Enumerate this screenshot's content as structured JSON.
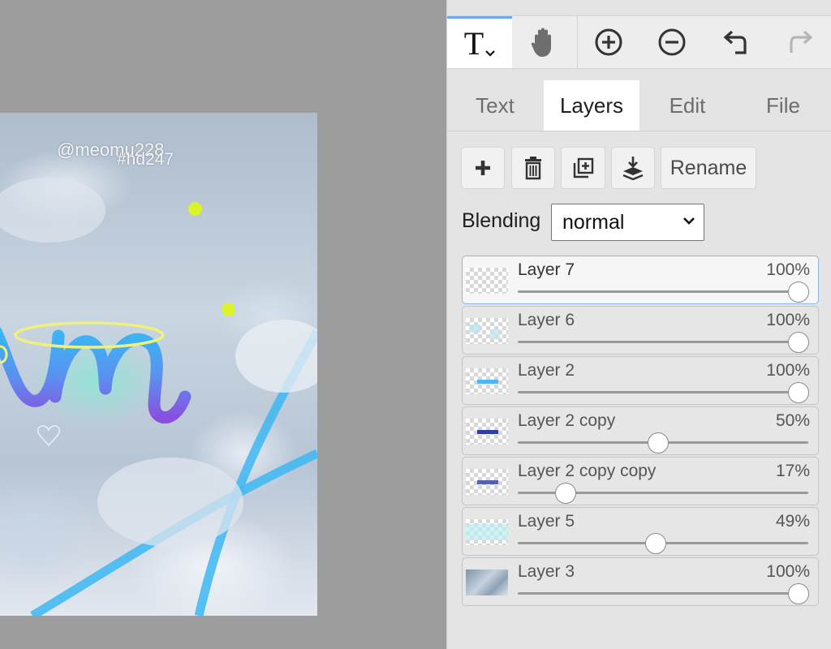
{
  "canvas": {
    "watermark_1": "@meomu228",
    "watermark_2": "#hd247"
  },
  "toolbar": {
    "tools": [
      {
        "name": "text-tool",
        "icon": "text-T-icon",
        "label": "T",
        "active": true
      },
      {
        "name": "hand-tool",
        "icon": "hand-icon"
      },
      {
        "name": "zoom-in",
        "icon": "plus-circle-icon"
      },
      {
        "name": "zoom-out",
        "icon": "minus-circle-icon"
      },
      {
        "name": "undo",
        "icon": "undo-icon"
      },
      {
        "name": "redo",
        "icon": "redo-icon",
        "disabled": true
      }
    ]
  },
  "tabs": [
    {
      "label": "Text",
      "active": false
    },
    {
      "label": "Layers",
      "active": true
    },
    {
      "label": "Edit",
      "active": false
    },
    {
      "label": "File",
      "active": false
    }
  ],
  "layer_actions": {
    "add_icon": "plus-icon",
    "delete_icon": "trash-icon",
    "duplicate_icon": "duplicate-icon",
    "merge_down_icon": "merge-down-icon",
    "rename_label": "Rename"
  },
  "blending": {
    "label": "Blending",
    "value": "normal"
  },
  "layers": [
    {
      "name": "Layer 7",
      "opacity_label": "100%",
      "opacity": 100,
      "selected": true
    },
    {
      "name": "Layer 6",
      "opacity_label": "100%",
      "opacity": 100,
      "selected": false
    },
    {
      "name": "Layer 2",
      "opacity_label": "100%",
      "opacity": 100,
      "selected": false
    },
    {
      "name": "Layer 2 copy",
      "opacity_label": "50%",
      "opacity": 50,
      "selected": false
    },
    {
      "name": "Layer 2 copy copy",
      "opacity_label": "17%",
      "opacity": 17,
      "selected": false
    },
    {
      "name": "Layer 5",
      "opacity_label": "49%",
      "opacity": 49,
      "selected": false
    },
    {
      "name": "Layer 3",
      "opacity_label": "100%",
      "opacity": 100,
      "selected": false
    }
  ],
  "colors": {
    "accent": "#6fa8ef",
    "panel_bg": "#e4e4e4",
    "workspace_bg": "#9d9d9d",
    "lettering_blue": "#3aa9f0",
    "lettering_purple": "#8a4fe0",
    "halo_yellow": "#eef27a",
    "dot_yellow": "#dcf22a"
  }
}
